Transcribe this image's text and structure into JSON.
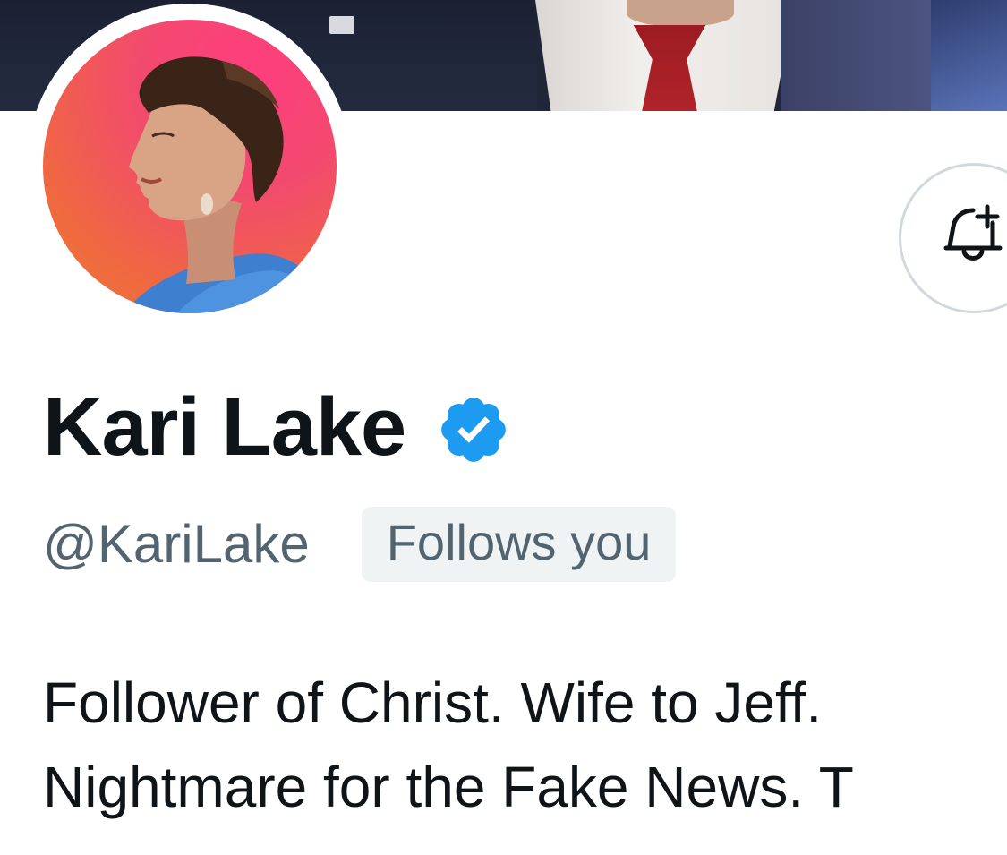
{
  "profile": {
    "display_name": "Kari Lake",
    "handle": "@KariLake",
    "follows_you_label": "Follows you",
    "verified": true,
    "bio_lines": [
      "Follower of Christ. Wife to Jeff.",
      "Nightmare for the Fake News. T"
    ]
  },
  "icons": {
    "verified": "verified-badge-icon",
    "notifications": "bell-plus-icon"
  },
  "colors": {
    "verified_blue": "#1d9bf0",
    "secondary_text": "#536471",
    "primary_text": "#0f1419",
    "badge_bg": "#eff3f4"
  }
}
